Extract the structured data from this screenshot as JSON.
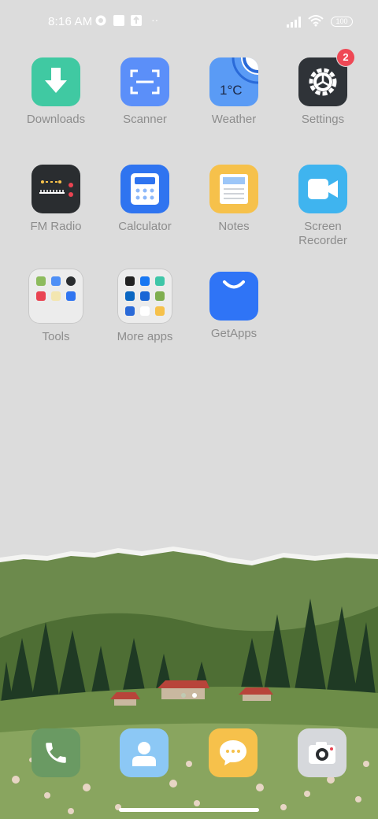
{
  "status_bar": {
    "time": "8:16 AM",
    "battery": "100",
    "more_indicator": "··"
  },
  "apps": [
    {
      "name": "Downloads",
      "color": "#40c9a2"
    },
    {
      "name": "Scanner",
      "color": "#5b8ff9"
    },
    {
      "name": "Weather",
      "color": "#5a9bf5",
      "temp": "1°C"
    },
    {
      "name": "Settings",
      "color": "#2f3338",
      "badge": "2"
    },
    {
      "name": "FM Radio",
      "color": "#2a2d30"
    },
    {
      "name": "Calculator",
      "color": "#2f74f0"
    },
    {
      "name": "Notes",
      "color": "#f6c14b"
    },
    {
      "name": "Screen\nRecorder",
      "color": "#3fb4ef"
    },
    {
      "name": "Tools"
    },
    {
      "name": "More apps"
    },
    {
      "name": "GetApps",
      "color": "#2f74f6"
    }
  ],
  "dock": [
    {
      "name": "phone-app",
      "color": "#6a9a63"
    },
    {
      "name": "contacts-app",
      "color": "#8cc8f5"
    },
    {
      "name": "messages-app",
      "color": "#f6c14b"
    },
    {
      "name": "camera-app",
      "color": "#d6d8dc"
    }
  ]
}
